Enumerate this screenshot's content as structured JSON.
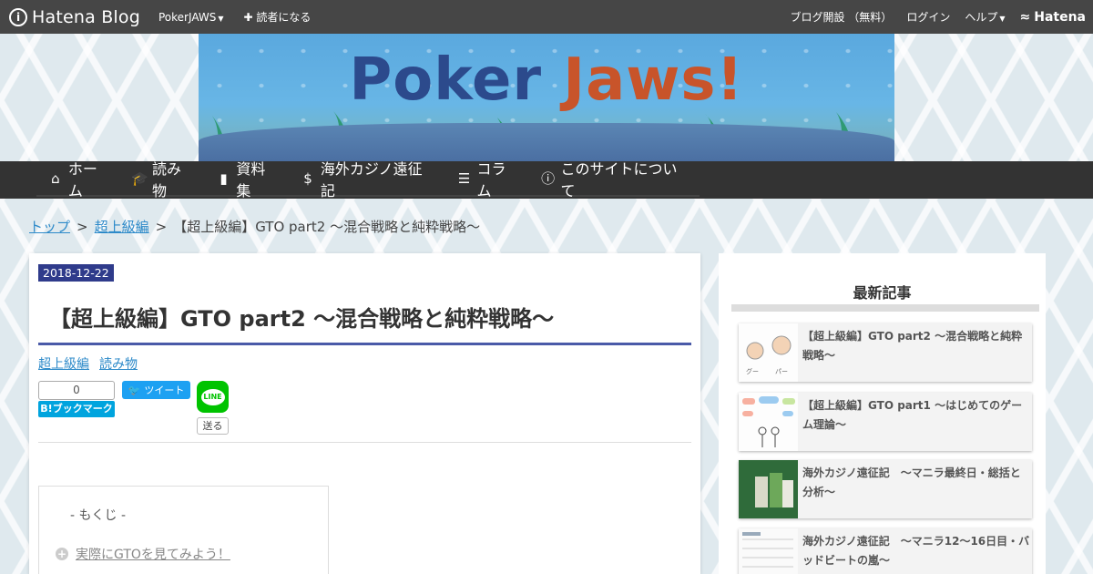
{
  "hatena_bar": {
    "logo_text": "Hatena Blog",
    "blog_name": "PokerJAWS",
    "subscribe": "読者になる",
    "open_blog": "ブログ開設 （無料）",
    "login": "ログイン",
    "help": "ヘルプ",
    "hatena": "Hatena"
  },
  "header": {
    "title_part1": "Poker",
    "title_part2": "Jaws!"
  },
  "global_nav": [
    {
      "label": "ホーム",
      "icon": "home-icon"
    },
    {
      "label": "読み物",
      "icon": "graduation-cap-icon"
    },
    {
      "label": "資料集",
      "icon": "book-icon"
    },
    {
      "label": "海外カジノ遠征記",
      "icon": "dollar-icon"
    },
    {
      "label": "コラム",
      "icon": "list-icon"
    },
    {
      "label": "このサイトについて",
      "icon": "info-icon"
    }
  ],
  "breadcrumb": {
    "home": "トップ",
    "category": "超上級編",
    "current": "【超上級編】GTO part2 〜混合戦略と純粋戦略〜"
  },
  "article": {
    "date": "2018-12-22",
    "title": "【超上級編】GTO part2 〜混合戦略と純粋戦略〜",
    "categories": [
      "超上級編",
      "読み物"
    ],
    "share": {
      "bookmark_count": "0",
      "bookmark_label": "B!ブックマーク",
      "tweet_label": "ツイート",
      "line_icon_text": "LINE",
      "line_send_label": "送る"
    },
    "toc": {
      "title": "- もくじ -",
      "items": [
        "実際にGTOを見てみよう！"
      ]
    }
  },
  "sidebar": {
    "recent_title": "最新記事",
    "recent": [
      {
        "title": "【超上級編】GTO part2 〜混合戦略と純粋戦略〜"
      },
      {
        "title": "【超上級編】GTO part1 〜はじめてのゲーム理論〜"
      },
      {
        "title": "海外カジノ遠征記　～マニラ最終日・総括と分析～"
      },
      {
        "title": "海外カジノ遠征記　～マニラ12〜16日目・バッドビートの嵐～"
      }
    ]
  },
  "colors": {
    "top_bar": "#464646",
    "nav_bar": "#333333",
    "date_badge": "#2f3b8b",
    "link": "#2d8ac9",
    "title_underline": "#4a5aa8"
  }
}
